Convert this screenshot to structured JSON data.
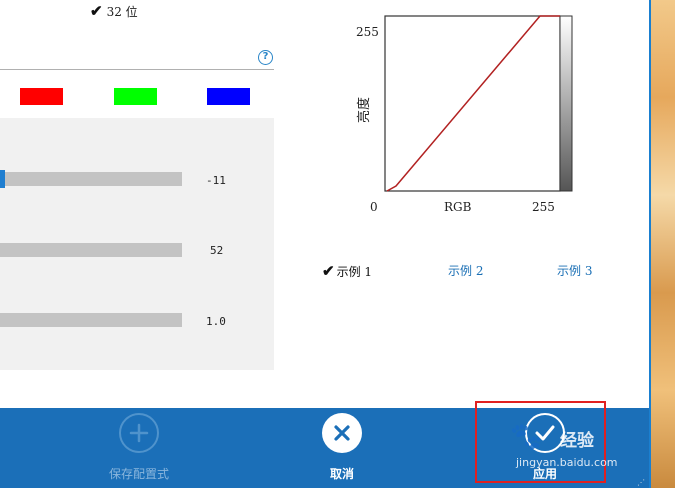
{
  "color_depth": {
    "checked": true,
    "label": "32 位"
  },
  "help": {
    "symbol": "?"
  },
  "channels": [
    {
      "name": "red",
      "color": "#ff0000"
    },
    {
      "name": "green",
      "color": "#00ff00"
    },
    {
      "name": "blue",
      "color": "#0000ff"
    }
  ],
  "sliders": [
    {
      "value": "-11",
      "fraction": 0.0
    },
    {
      "value": "52"
    },
    {
      "value": "1.0"
    }
  ],
  "curve": {
    "y_axis_label": "亮度",
    "y_max_label": "255",
    "x_min_label": "0",
    "x_axis_label": "RGB",
    "x_max_label": "255",
    "line_color": "#b22222"
  },
  "samples": [
    {
      "label": "示例 1",
      "selected": true
    },
    {
      "label": "示例 2",
      "selected": false
    },
    {
      "label": "示例 3",
      "selected": false
    }
  ],
  "actions": {
    "save_preset": {
      "label": "保存配置式",
      "enabled": false,
      "icon": "plus-icon"
    },
    "cancel": {
      "label": "取消",
      "enabled": true,
      "icon": "close-icon"
    },
    "apply": {
      "label": "应用",
      "enabled": true,
      "icon": "check-icon"
    }
  },
  "watermark": {
    "brand": "经验",
    "url": "jingyan.baidu.com"
  }
}
